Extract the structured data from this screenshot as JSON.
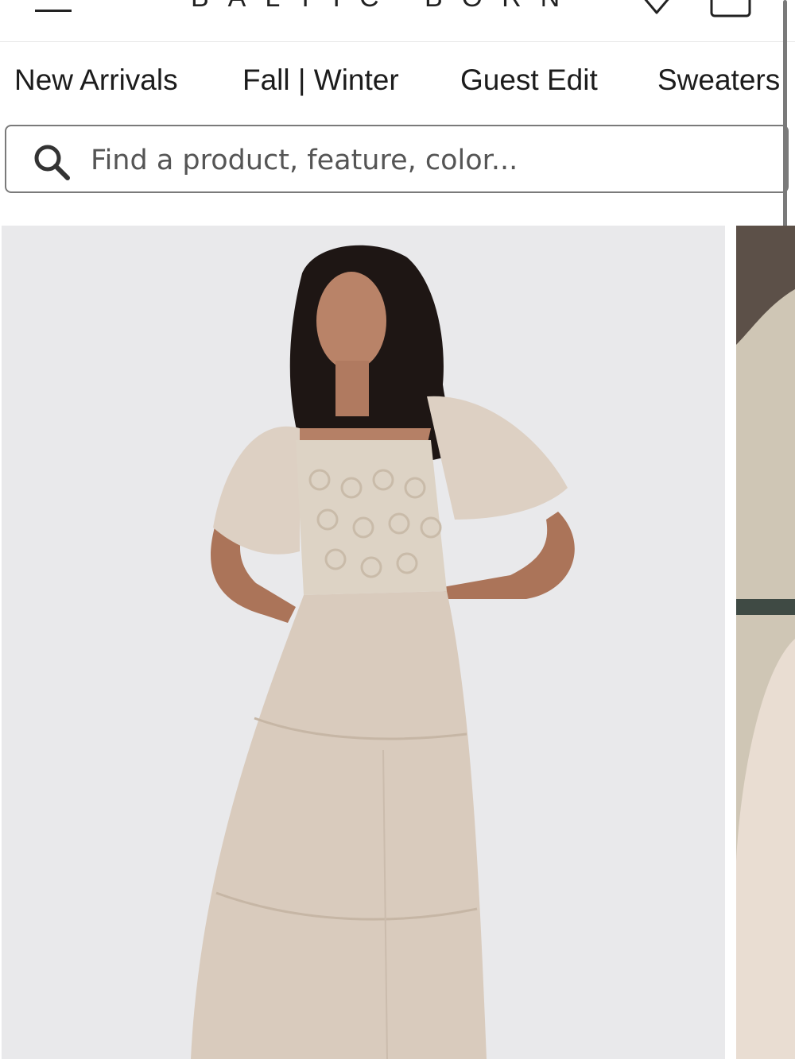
{
  "header": {
    "logo_text": "BALTIC BORN",
    "icons": [
      "menu-icon",
      "heart-icon",
      "shopping-bag-icon"
    ]
  },
  "nav": {
    "items": [
      {
        "label": "New Arrivals"
      },
      {
        "label": "Fall | Winter"
      },
      {
        "label": "Guest Edit"
      },
      {
        "label": "Sweaters"
      }
    ]
  },
  "search": {
    "placeholder": "Find a product, feature, color...",
    "value": ""
  },
  "products": [
    {
      "image": "model-in-beige-lace-tiered-midi-dress",
      "background": "#e9e9eb"
    },
    {
      "image": "outdoor-product-photo-partially-visible"
    }
  ],
  "colors": {
    "text": "#1c1c1c",
    "border": "#7a7a7a",
    "image_bg": "#e9e9eb",
    "dress": "#d9cbbd"
  }
}
